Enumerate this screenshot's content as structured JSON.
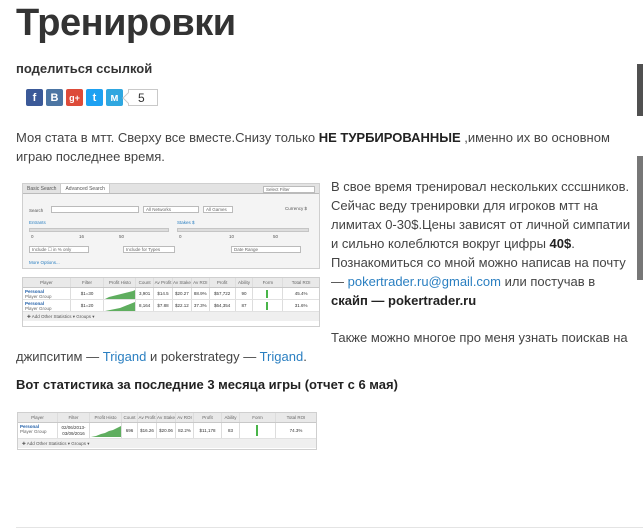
{
  "title": "Тренировки",
  "share": {
    "heading": "поделиться ссылкой",
    "buttons": [
      {
        "icon": "facebook-icon",
        "glyph": "f",
        "color": "#3b5998"
      },
      {
        "icon": "vkontakte-icon",
        "glyph": "B",
        "color": "#4c75a3"
      },
      {
        "icon": "googleplus-icon",
        "glyph": "g+",
        "color": "#dd4b39"
      },
      {
        "icon": "twitter-icon",
        "glyph": "t",
        "color": "#1da1f2"
      },
      {
        "icon": "moikrug-icon",
        "glyph": "м",
        "color": "#2fa7e0"
      }
    ],
    "count": "5"
  },
  "intro": {
    "text1": "Моя стата в мтт. Сверху все вместе.Снизу только ",
    "bold": "НЕ ТУРБИРОВАННЫЕ",
    "text2": " ,именно их во основном играю последнее время."
  },
  "about": {
    "p1": "В свое время тренировал нескольких сссшников. Сейчас веду тренировки для игроков мтт на лимитах 0-30$.Цены зависят от личной симпатии и сильно колеблются вокруг цифры ",
    "price": "40$",
    "p1end": ".",
    "p2a": "Познакомиться со мной можно написав на почту — ",
    "email": "pokertrader.ru@gmail.com",
    "p2b": " или постучав в ",
    "skype_label": "скайп — pokertrader.ru",
    "p3a": "Также можно многое про меня узнать поискав на джипситим — ",
    "link1": "Trigand",
    "p3b": " и pokerstrategy — ",
    "link2": "Trigand",
    "p3end": "."
  },
  "stats_heading": "Вот статистика за последние 3 месяца игры (отчет с 6 мая)",
  "search_panel": {
    "tabs": [
      "Basic Search",
      "Advanced Search"
    ],
    "select_filter": "Select Filter",
    "search_label": "Search",
    "networks": "All Networks",
    "games": "All Games",
    "currency_label": "Currency $",
    "entrants_label": "Entrants",
    "stakes_label": "Stakes $",
    "entrants_ticks": [
      "0",
      "16",
      "50"
    ],
    "stakes_ticks": [
      "0",
      "10",
      "50"
    ],
    "include_label": "Include ☐ in % only",
    "types": "Include for Types",
    "date_range": "Date Range",
    "more_options": "More Options..."
  },
  "table1": {
    "headers": [
      "Player",
      "Filter",
      "Profit Histo",
      "Count",
      "Av Profit",
      "Av Stake",
      "Av ROI",
      "Profit",
      "Ability",
      "Form",
      "Total ROI"
    ],
    "rows": [
      {
        "player": "Personal",
        "group": "Player Group",
        "filter": "$1=30",
        "count": "3,901",
        "avprofit": "$14.5",
        "avstake": "$20.27",
        "avroi": "88.9%",
        "profit": "$57,722",
        "ability": "90",
        "total": "45.4%"
      },
      {
        "player": "Personal",
        "group": "Player Group",
        "filter": "$1=20",
        "count": "8,164",
        "avprofit": "$7.88",
        "avstake": "$22.12",
        "avroi": "37.3%",
        "profit": "$64,354",
        "ability": "87",
        "total": "31.6%"
      }
    ],
    "footer": "✚ Add Other Statistics   ▾ Groups ▾"
  },
  "table2": {
    "headers": [
      "Player",
      "Filter",
      "Profit Histo",
      "Count",
      "Av Profit",
      "Av Stake",
      "Av ROI",
      "Profit",
      "Ability",
      "Form",
      "Total ROI"
    ],
    "rows": [
      {
        "player": "Personal",
        "group": "Player Group",
        "filter": "02/06/2013-03/09/2016",
        "count": "696",
        "avprofit": "$16.26",
        "avstake": "$20.06",
        "avroi": "82.2%",
        "profit": "$11,178",
        "ability": "83",
        "total": "74.3%"
      }
    ],
    "footer": "✚ Add Other Statistics   ▾ Groups ▾"
  }
}
